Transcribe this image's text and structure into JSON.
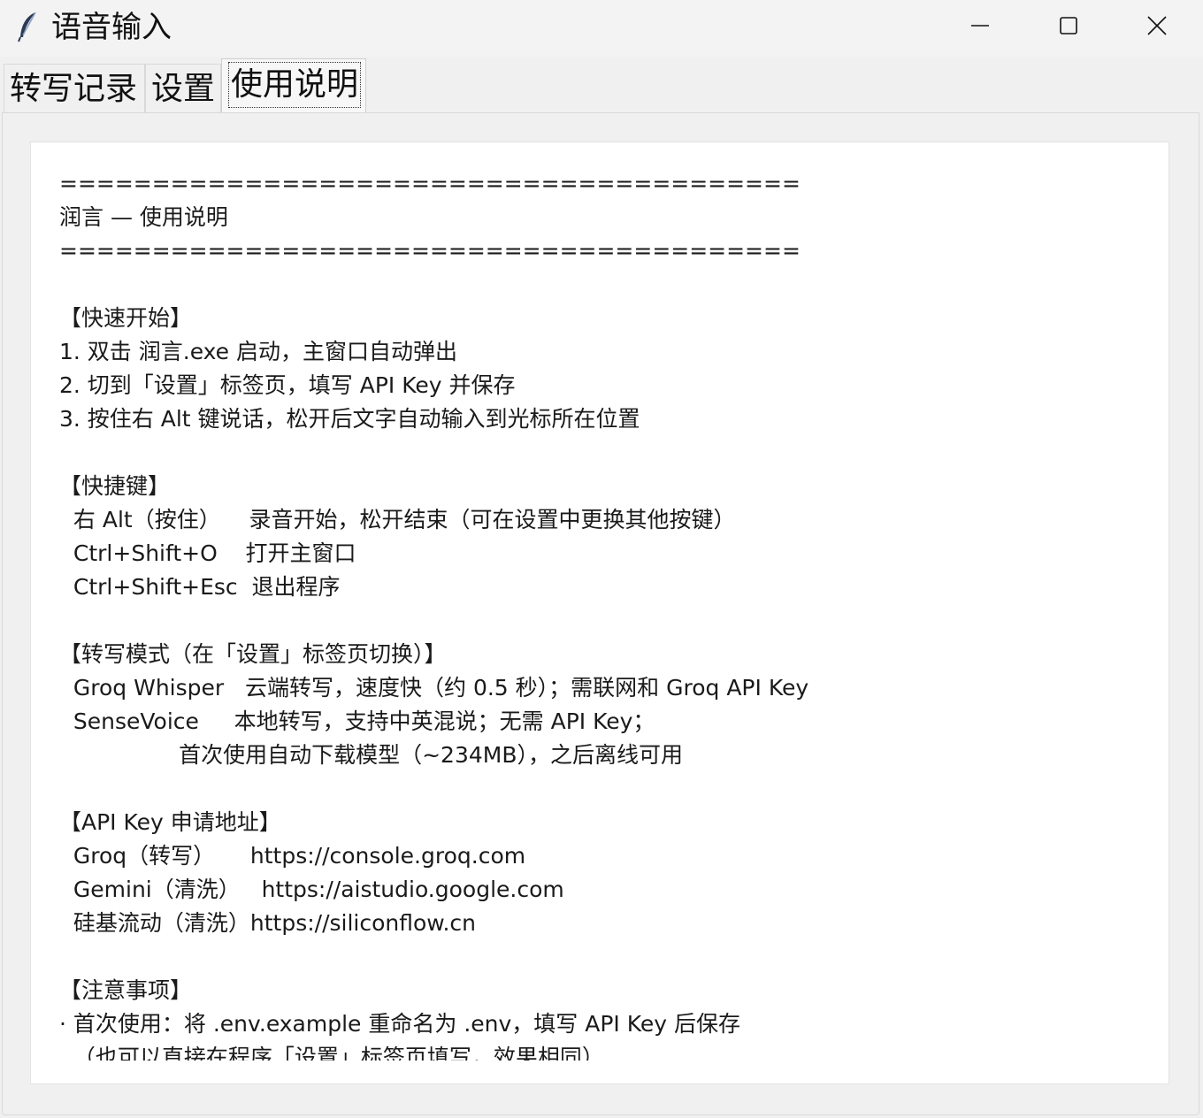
{
  "window": {
    "title": "语音输入",
    "app_icon": "feather-icon",
    "controls": {
      "minimize": "minimize-icon",
      "maximize": "maximize-icon",
      "close": "close-icon"
    }
  },
  "tabs": [
    {
      "label": "转写记录",
      "active": false
    },
    {
      "label": "设置",
      "active": false
    },
    {
      "label": "使用说明",
      "active": true
    }
  ],
  "doc_lines": [
    "========================================",
    "润言 — 使用说明",
    "========================================",
    "",
    "【快速开始】",
    "1. 双击 润言.exe 启动，主窗口自动弹出",
    "2. 切到「设置」标签页，填写 API Key 并保存",
    "3. 按住右 Alt 键说话，松开后文字自动输入到光标所在位置",
    "",
    "【快捷键】",
    "  右 Alt（按住）    录音开始，松开结束（可在设置中更换其他按键）",
    "  Ctrl+Shift+O    打开主窗口",
    "  Ctrl+Shift+Esc  退出程序",
    "",
    "【转写模式（在「设置」标签页切换）】",
    "  Groq Whisper   云端转写，速度快（约 0.5 秒）；需联网和 Groq API Key",
    "  SenseVoice     本地转写，支持中英混说；无需 API Key；",
    "                 首次使用自动下载模型（~234MB），之后离线可用",
    "",
    "【API Key 申请地址】",
    "  Groq（转写）     https://console.groq.com",
    "  Gemini（清洗）   https://aistudio.google.com",
    "  硅基流动（清洗）https://siliconflow.cn",
    "",
    "【注意事项】",
    "· 首次使用：将 .env.example 重命名为 .env，填写 API Key 后保存",
    "  （也可以直接在程序「设置」标签页填写，效果相同）"
  ],
  "colors": {
    "window_bg": "#f0f0f0",
    "doc_bg": "#ffffff",
    "text": "#1a1a1a"
  }
}
